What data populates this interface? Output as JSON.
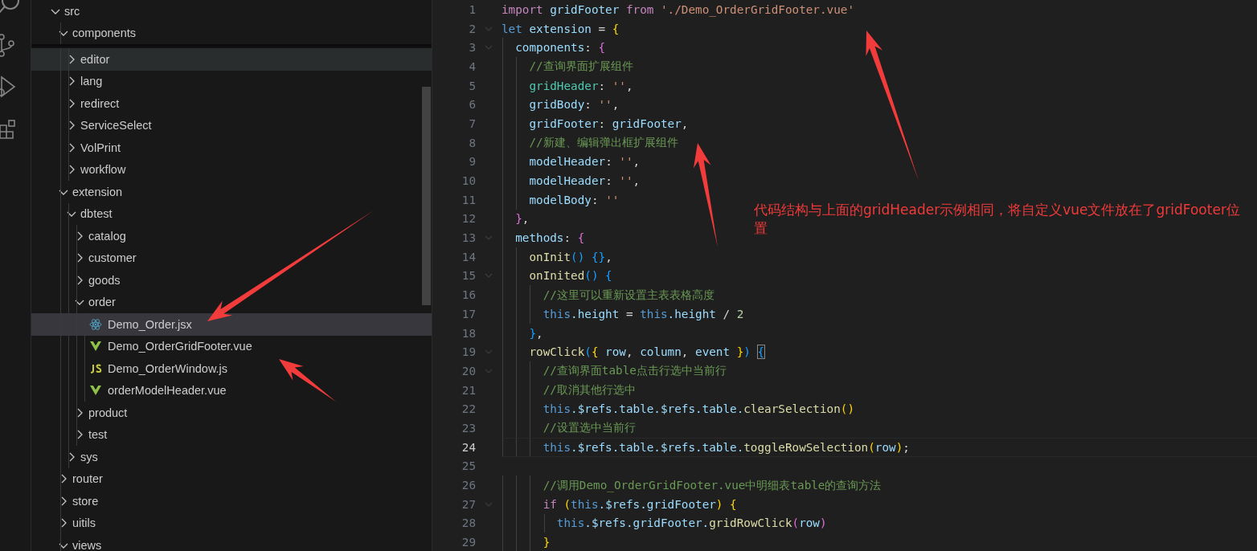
{
  "sidebar": {
    "tree": [
      {
        "label": "src",
        "kind": "folder",
        "expanded": true,
        "selected": false,
        "hovered": false,
        "children": [
          {
            "label": "components",
            "kind": "folder",
            "expanded": true,
            "selected": false,
            "hovered": false,
            "children": [
              {
                "label": "editor",
                "kind": "folder",
                "expanded": false,
                "selected": false,
                "hovered": true
              },
              {
                "label": "lang",
                "kind": "folder",
                "expanded": false,
                "selected": false,
                "hovered": false
              },
              {
                "label": "redirect",
                "kind": "folder",
                "expanded": false,
                "selected": false,
                "hovered": false
              },
              {
                "label": "ServiceSelect",
                "kind": "folder",
                "expanded": false,
                "selected": false,
                "hovered": false
              },
              {
                "label": "VolPrint",
                "kind": "folder",
                "expanded": false,
                "selected": false,
                "hovered": false
              },
              {
                "label": "workflow",
                "kind": "folder",
                "expanded": false,
                "selected": false,
                "hovered": false
              }
            ]
          },
          {
            "label": "extension",
            "kind": "folder",
            "expanded": true,
            "selected": false,
            "hovered": false,
            "children": [
              {
                "label": "dbtest",
                "kind": "folder",
                "expanded": true,
                "selected": false,
                "hovered": false,
                "children": [
                  {
                    "label": "catalog",
                    "kind": "folder",
                    "expanded": false,
                    "selected": false,
                    "hovered": false
                  },
                  {
                    "label": "customer",
                    "kind": "folder",
                    "expanded": false,
                    "selected": false,
                    "hovered": false
                  },
                  {
                    "label": "goods",
                    "kind": "folder",
                    "expanded": false,
                    "selected": false,
                    "hovered": false
                  },
                  {
                    "label": "order",
                    "kind": "folder",
                    "expanded": true,
                    "selected": false,
                    "hovered": false,
                    "children": [
                      {
                        "label": "Demo_Order.jsx",
                        "kind": "react",
                        "selected": true,
                        "hovered": false
                      },
                      {
                        "label": "Demo_OrderGridFooter.vue",
                        "kind": "vue",
                        "selected": false,
                        "hovered": false
                      },
                      {
                        "label": "Demo_OrderWindow.js",
                        "kind": "js",
                        "selected": false,
                        "hovered": false
                      },
                      {
                        "label": "orderModelHeader.vue",
                        "kind": "vue",
                        "selected": false,
                        "hovered": false
                      }
                    ]
                  },
                  {
                    "label": "product",
                    "kind": "folder",
                    "expanded": false,
                    "selected": false,
                    "hovered": false
                  },
                  {
                    "label": "test",
                    "kind": "folder",
                    "expanded": false,
                    "selected": false,
                    "hovered": false
                  }
                ]
              },
              {
                "label": "sys",
                "kind": "folder",
                "expanded": false,
                "selected": false,
                "hovered": false
              }
            ]
          },
          {
            "label": "router",
            "kind": "folder",
            "expanded": false,
            "selected": false,
            "hovered": false
          },
          {
            "label": "store",
            "kind": "folder",
            "expanded": false,
            "selected": false,
            "hovered": false
          },
          {
            "label": "uitils",
            "kind": "folder",
            "expanded": false,
            "selected": false,
            "hovered": false
          },
          {
            "label": "views",
            "kind": "folder",
            "expanded": true,
            "selected": false,
            "hovered": false
          }
        ]
      }
    ]
  },
  "editor": {
    "lines": [
      {
        "number": "1",
        "foldable": false,
        "current": false,
        "tokens": [
          {
            "text": "import",
            "kind": "kw"
          },
          {
            "text": " gridFooter ",
            "kind": "var"
          },
          {
            "text": "from",
            "kind": "kw"
          },
          {
            "text": " './Demo_OrderGridFooter.vue'",
            "kind": "str"
          }
        ]
      },
      {
        "number": "2",
        "foldable": true,
        "current": false,
        "tokens": [
          {
            "text": "let",
            "kind": "storage"
          },
          {
            "text": " extension",
            "kind": "var"
          },
          {
            "text": " = ",
            "kind": "punc"
          },
          {
            "text": "{",
            "kind": "b1"
          }
        ]
      },
      {
        "number": "3",
        "foldable": true,
        "current": false,
        "tokens": [
          {
            "text": "  components",
            "kind": "var"
          },
          {
            "text": ": ",
            "kind": "punc"
          },
          {
            "text": "{",
            "kind": "b2"
          }
        ]
      },
      {
        "number": "4",
        "foldable": false,
        "current": false,
        "tokens": [
          {
            "text": "    //查询界面扩展组件",
            "kind": "comment"
          }
        ]
      },
      {
        "number": "5",
        "foldable": false,
        "current": false,
        "tokens": [
          {
            "text": "    gridHeader",
            "kind": "type"
          },
          {
            "text": ": ",
            "kind": "punc"
          },
          {
            "text": "''",
            "kind": "str"
          },
          {
            "text": ",",
            "kind": "punc"
          }
        ]
      },
      {
        "number": "6",
        "foldable": false,
        "current": false,
        "tokens": [
          {
            "text": "    gridBody",
            "kind": "var"
          },
          {
            "text": ": ",
            "kind": "punc"
          },
          {
            "text": "''",
            "kind": "str"
          },
          {
            "text": ",",
            "kind": "punc"
          }
        ]
      },
      {
        "number": "7",
        "foldable": false,
        "current": false,
        "tokens": [
          {
            "text": "    gridFooter",
            "kind": "var"
          },
          {
            "text": ": ",
            "kind": "punc"
          },
          {
            "text": "gridFooter",
            "kind": "var"
          },
          {
            "text": ",",
            "kind": "punc"
          }
        ]
      },
      {
        "number": "8",
        "foldable": false,
        "current": false,
        "tokens": [
          {
            "text": "    //新建、编辑弹出框扩展组件",
            "kind": "comment"
          }
        ]
      },
      {
        "number": "9",
        "foldable": false,
        "current": false,
        "tokens": [
          {
            "text": "    modelHeader",
            "kind": "var"
          },
          {
            "text": ": ",
            "kind": "punc"
          },
          {
            "text": "''",
            "kind": "str"
          },
          {
            "text": ",",
            "kind": "punc"
          }
        ]
      },
      {
        "number": "10",
        "foldable": false,
        "current": false,
        "tokens": [
          {
            "text": "    modelHeader",
            "kind": "var"
          },
          {
            "text": ": ",
            "kind": "punc"
          },
          {
            "text": "''",
            "kind": "str"
          },
          {
            "text": ",",
            "kind": "punc"
          }
        ]
      },
      {
        "number": "11",
        "foldable": false,
        "current": false,
        "tokens": [
          {
            "text": "    modelBody",
            "kind": "var"
          },
          {
            "text": ": ",
            "kind": "punc"
          },
          {
            "text": "''",
            "kind": "str"
          }
        ]
      },
      {
        "number": "12",
        "foldable": false,
        "current": false,
        "tokens": [
          {
            "text": "  }",
            "kind": "b2"
          },
          {
            "text": ",",
            "kind": "punc"
          }
        ]
      },
      {
        "number": "13",
        "foldable": true,
        "current": false,
        "tokens": [
          {
            "text": "  methods",
            "kind": "var"
          },
          {
            "text": ": ",
            "kind": "punc"
          },
          {
            "text": "{",
            "kind": "b2"
          }
        ]
      },
      {
        "number": "14",
        "foldable": false,
        "current": false,
        "tokens": [
          {
            "text": "    onInit",
            "kind": "func"
          },
          {
            "text": "() {}",
            "kind": "b3"
          },
          {
            "text": ",",
            "kind": "punc"
          }
        ]
      },
      {
        "number": "15",
        "foldable": true,
        "current": false,
        "tokens": [
          {
            "text": "    onInited",
            "kind": "func"
          },
          {
            "text": "() {",
            "kind": "b3"
          }
        ]
      },
      {
        "number": "16",
        "foldable": false,
        "current": false,
        "tokens": [
          {
            "text": "      //这里可以重新设置主表表格高度",
            "kind": "comment"
          }
        ]
      },
      {
        "number": "17",
        "foldable": false,
        "current": false,
        "tokens": [
          {
            "text": "      this",
            "kind": "storage"
          },
          {
            "text": ".height",
            "kind": "var"
          },
          {
            "text": " = ",
            "kind": "punc"
          },
          {
            "text": "this",
            "kind": "storage"
          },
          {
            "text": ".height",
            "kind": "var"
          },
          {
            "text": " / ",
            "kind": "punc"
          },
          {
            "text": "2",
            "kind": "num"
          }
        ]
      },
      {
        "number": "18",
        "foldable": false,
        "current": false,
        "tokens": [
          {
            "text": "    }",
            "kind": "b3"
          },
          {
            "text": ",",
            "kind": "punc"
          }
        ]
      },
      {
        "number": "19",
        "foldable": true,
        "current": false,
        "tokens": [
          {
            "text": "    rowClick",
            "kind": "func"
          },
          {
            "text": "(",
            "kind": "b3"
          },
          {
            "text": "{",
            "kind": "b1"
          },
          {
            "text": " row",
            "kind": "var"
          },
          {
            "text": ", ",
            "kind": "punc"
          },
          {
            "text": "column",
            "kind": "var"
          },
          {
            "text": ", ",
            "kind": "punc"
          },
          {
            "text": "event ",
            "kind": "var"
          },
          {
            "text": "}",
            "kind": "b1"
          },
          {
            "text": ") ",
            "kind": "b3"
          },
          {
            "text": "{",
            "kind": "match"
          }
        ]
      },
      {
        "number": "20",
        "foldable": true,
        "current": false,
        "tokens": [
          {
            "text": "      //查询界面table点击行选中当前行",
            "kind": "comment"
          }
        ]
      },
      {
        "number": "21",
        "foldable": false,
        "current": false,
        "tokens": [
          {
            "text": "      //取消其他行选中",
            "kind": "comment"
          }
        ]
      },
      {
        "number": "22",
        "foldable": false,
        "current": false,
        "tokens": [
          {
            "text": "      this",
            "kind": "storage"
          },
          {
            "text": ".$refs.table.$refs.table.",
            "kind": "var"
          },
          {
            "text": "clearSelection",
            "kind": "func"
          },
          {
            "text": "()",
            "kind": "b1"
          }
        ]
      },
      {
        "number": "23",
        "foldable": false,
        "current": false,
        "tokens": [
          {
            "text": "      //设置选中当前行",
            "kind": "comment"
          }
        ]
      },
      {
        "number": "24",
        "foldable": false,
        "current": true,
        "tokens": [
          {
            "text": "      this",
            "kind": "storage"
          },
          {
            "text": ".$refs.table.$refs.table.",
            "kind": "var"
          },
          {
            "text": "toggleRowSelection",
            "kind": "func"
          },
          {
            "text": "(",
            "kind": "b1"
          },
          {
            "text": "row",
            "kind": "var"
          },
          {
            "text": ")",
            "kind": "b1"
          },
          {
            "text": ";",
            "kind": "punc"
          }
        ]
      },
      {
        "number": "25",
        "foldable": false,
        "current": false
      },
      {
        "number": "26",
        "foldable": false,
        "current": false,
        "tokens": [
          {
            "text": "      //调用Demo_OrderGridFooter.vue中明细表table的查询方法",
            "kind": "comment"
          }
        ]
      },
      {
        "number": "27",
        "foldable": true,
        "current": false,
        "tokens": [
          {
            "text": "      if",
            "kind": "kw"
          },
          {
            "text": " (",
            "kind": "b1"
          },
          {
            "text": "this",
            "kind": "storage"
          },
          {
            "text": ".$refs.gridFooter",
            "kind": "var"
          },
          {
            "text": ") {",
            "kind": "b1"
          }
        ]
      },
      {
        "number": "28",
        "foldable": false,
        "current": false,
        "tokens": [
          {
            "text": "        this",
            "kind": "storage"
          },
          {
            "text": ".$refs.gridFooter.",
            "kind": "var"
          },
          {
            "text": "gridRowClick",
            "kind": "func"
          },
          {
            "text": "(",
            "kind": "b2"
          },
          {
            "text": "row",
            "kind": "var"
          },
          {
            "text": ")",
            "kind": "b2"
          }
        ]
      },
      {
        "number": "29",
        "foldable": false,
        "current": false,
        "tokens": [
          {
            "text": "      }",
            "kind": "b1"
          }
        ]
      }
    ]
  },
  "annotation": {
    "text": "代码结构与上面的gridHeader示例相同，将自定义vue文件放在了gridFooter位置"
  }
}
